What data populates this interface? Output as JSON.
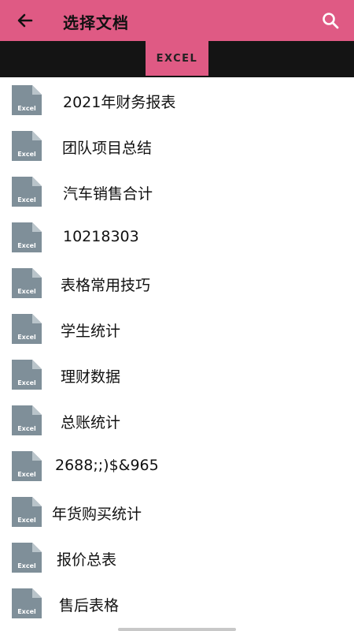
{
  "header": {
    "title": "选择文档",
    "back_icon": "arrow-left-icon",
    "search_icon": "search-icon",
    "accent_color": "#df5a84"
  },
  "tabs": [
    {
      "label": "EXCEL",
      "selected": true
    }
  ],
  "files": [
    {
      "name": "2021年财务报表",
      "badge": "Excel"
    },
    {
      "name": "团队项目总结",
      "badge": "Excel"
    },
    {
      "name": "汽车销售合计",
      "badge": "Excel"
    },
    {
      "name": "10218303",
      "badge": "Excel"
    },
    {
      "name": "表格常用技巧",
      "badge": "Excel"
    },
    {
      "name": "学生统计",
      "badge": "Excel"
    },
    {
      "name": "理财数据",
      "badge": "Excel"
    },
    {
      "name": "总账统计",
      "badge": "Excel"
    },
    {
      "name": "2688;;)$&965",
      "badge": "Excel"
    },
    {
      "name": "年货购买统计",
      "badge": "Excel"
    },
    {
      "name": "报价总表",
      "badge": "Excel"
    },
    {
      "name": "售后表格",
      "badge": "Excel"
    }
  ]
}
